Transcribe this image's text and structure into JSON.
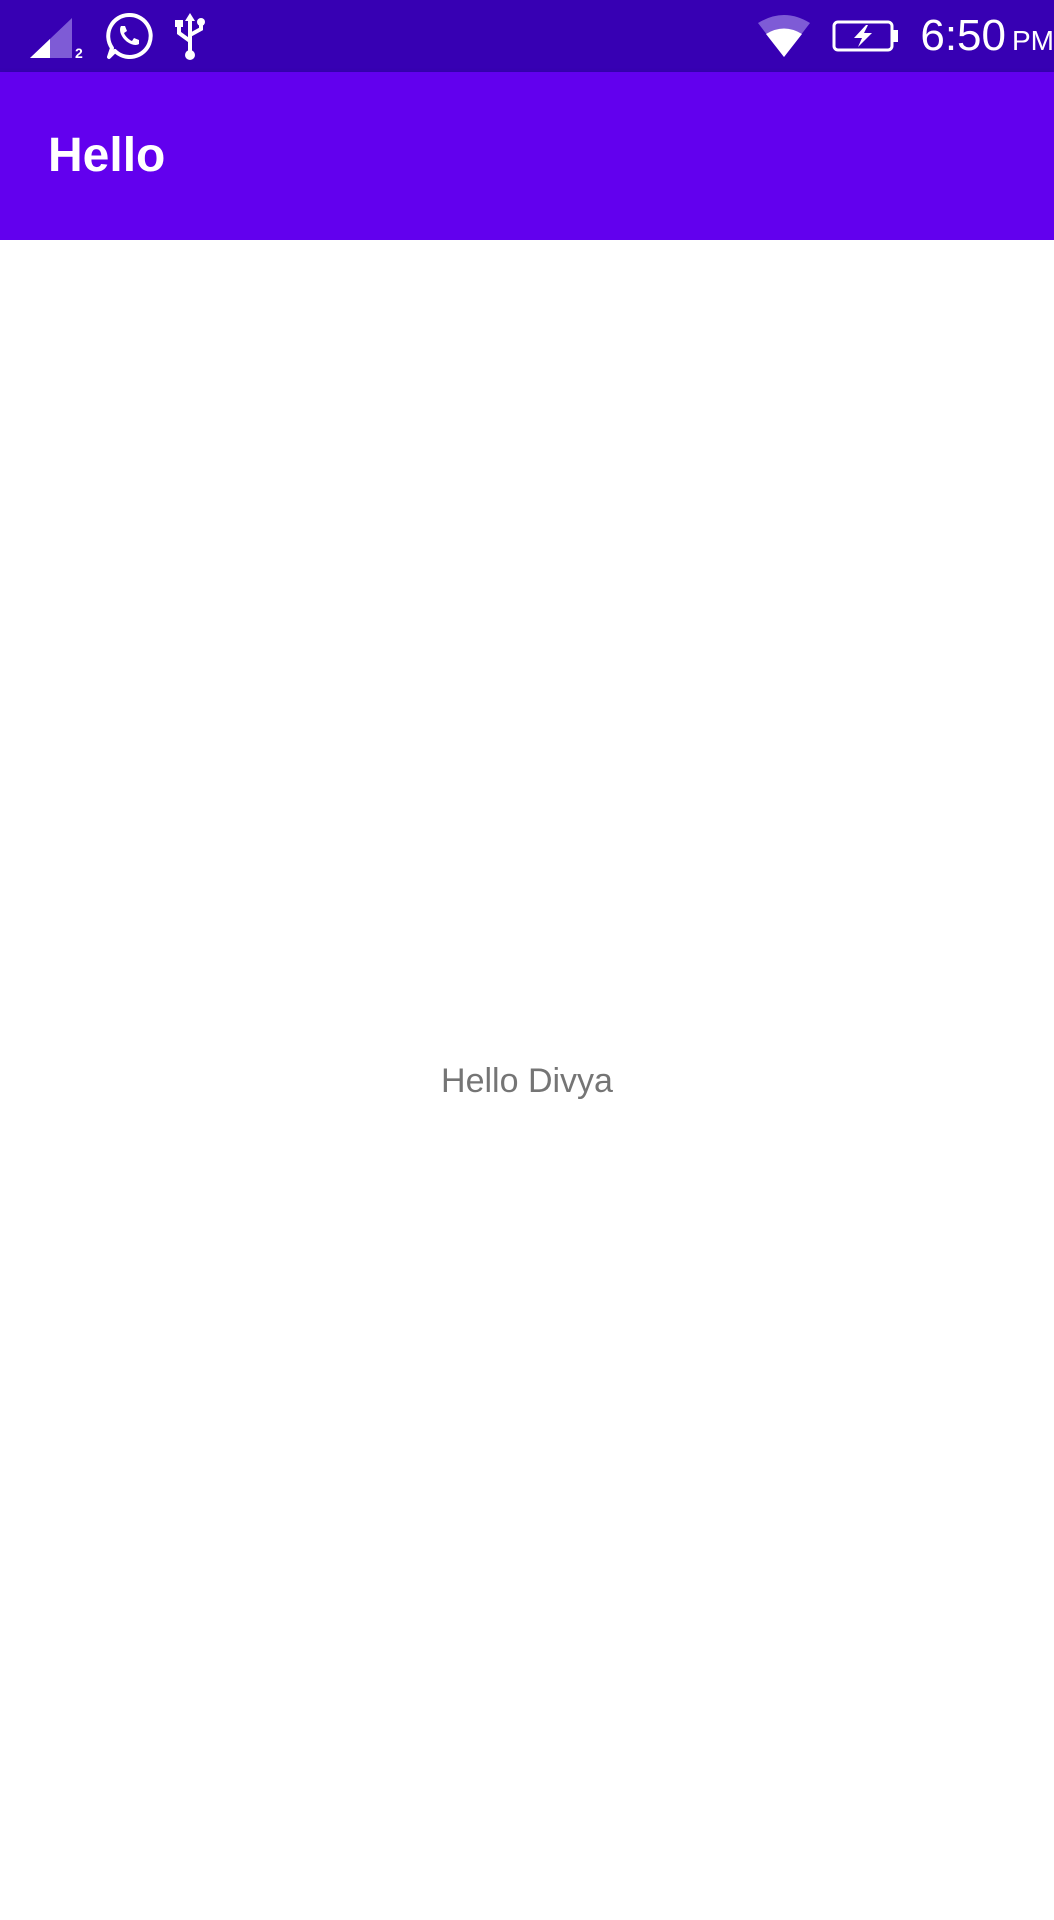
{
  "status_bar": {
    "background": "#3700B3",
    "sim_slot": "2",
    "time": "6:50",
    "ampm": "PM",
    "icons": [
      "signal-icon",
      "whatsapp-icon",
      "usb-icon",
      "wifi-icon",
      "battery-charging-icon"
    ]
  },
  "app_bar": {
    "title": "Hello",
    "background": "#6200EE"
  },
  "main": {
    "greeting": "Hello Divya",
    "text_color": "#757575"
  }
}
